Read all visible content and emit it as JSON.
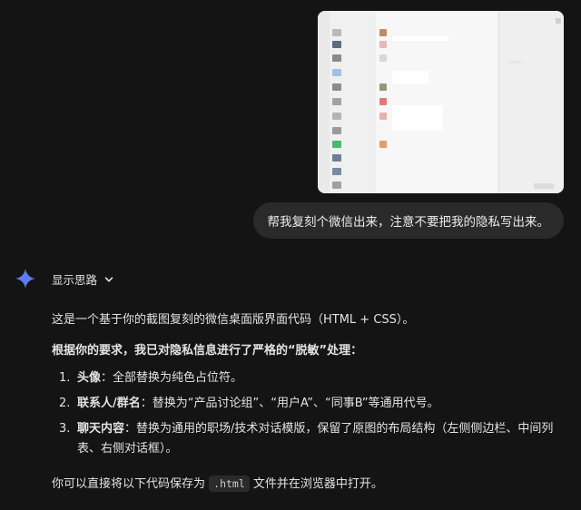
{
  "user_message": {
    "text": "帮我复刻个微信出来，注意不要把我的隐私写出来。"
  },
  "assistant": {
    "thoughts_label": "显示思路",
    "intro": "这是一个基于你的截图复刻的微信桌面版界面代码（HTML + CSS）。",
    "privacy_heading": "根据你的要求，我已对隐私信息进行了严格的“脱敏”处理：",
    "points": [
      {
        "num": "1.",
        "title": "头像",
        "text": "：全部替换为纯色占位符。"
      },
      {
        "num": "2.",
        "title": "联系人/群名",
        "text": "：替换为“产品讨论组”、“用户A”、“同事B”等通用代号。"
      },
      {
        "num": "3.",
        "title": "聊天内容",
        "text": "：替换为通用的职场/技术对话模版，保留了原图的布局结构（左侧侧边栏、中间列表、右侧对话框）。"
      }
    ],
    "closing_before": "你可以直接将以下代码保存为",
    "closing_code": ".html",
    "closing_after": "文件并在浏览器中打开。"
  },
  "colors": {
    "background": "#141414",
    "bubble": "#2a2a2a",
    "spark_top": "#4f8df5",
    "spark_bottom": "#6b6cf0"
  },
  "icons": {
    "spark": "gemini-spark-icon",
    "chevron": "chevron-down-icon"
  }
}
